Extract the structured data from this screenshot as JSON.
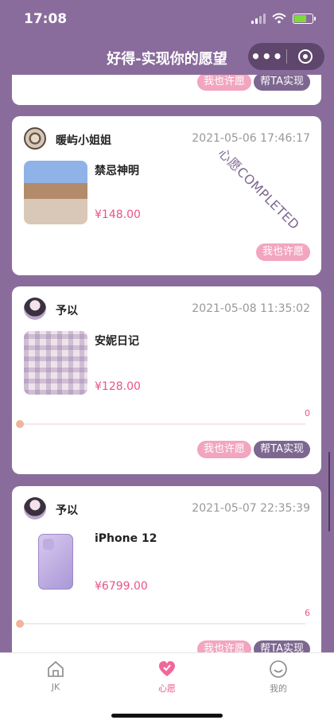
{
  "status": {
    "time": "17:08"
  },
  "nav": {
    "title": "好得-实现你的愿望",
    "more": "•••"
  },
  "cards": [
    {
      "wish_label": "我也许愿",
      "help_label": "帮TA实现"
    },
    {
      "user": "暖屿小姐姐",
      "time": "2021-05-06 17:46:17",
      "product": "禁忌神明",
      "price": "¥148.00",
      "stamp": "心愿COMPLETED",
      "wish_label": "我也许愿"
    },
    {
      "user": "予以",
      "time": "2021-05-08 11:35:02",
      "product": "安妮日记",
      "price": "¥128.00",
      "progress": "0",
      "wish_label": "我也许愿",
      "help_label": "帮TA实现"
    },
    {
      "user": "予以",
      "time": "2021-05-07 22:35:39",
      "product": "iPhone 12",
      "price": "¥6799.00",
      "progress": "6",
      "wish_label": "我也许愿",
      "help_label": "帮TA实现"
    }
  ],
  "tabs": [
    {
      "label": "JK",
      "icon": "home-icon"
    },
    {
      "label": "心愿",
      "icon": "heart-icon"
    },
    {
      "label": "我的",
      "icon": "smile-icon"
    }
  ],
  "colors": {
    "background": "#8a6c9c",
    "pink": "#e8548a",
    "wish_button": "#f2a5c0",
    "help_button": "#7d6790"
  }
}
